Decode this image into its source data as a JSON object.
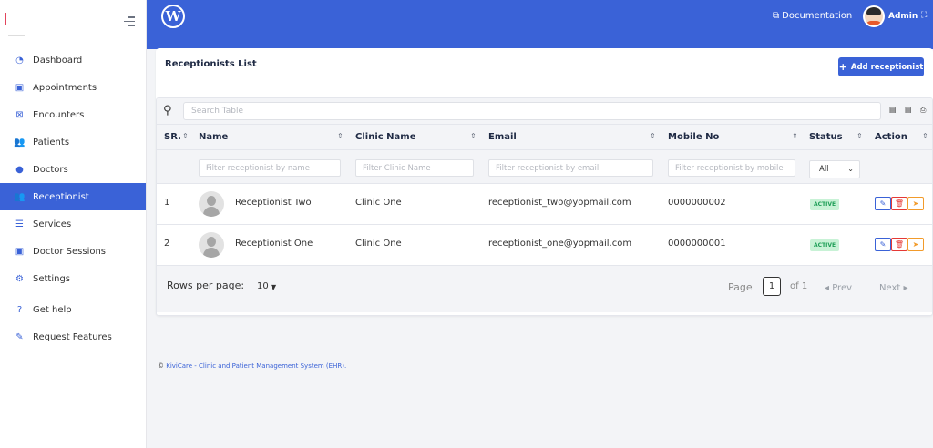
{
  "sidebar": {
    "items": [
      {
        "label": "Dashboard",
        "icon": "dashboard-icon"
      },
      {
        "label": "Appointments",
        "icon": "calendar-icon"
      },
      {
        "label": "Encounters",
        "icon": "calendar-x-icon"
      },
      {
        "label": "Patients",
        "icon": "patients-icon"
      },
      {
        "label": "Doctors",
        "icon": "user-icon"
      },
      {
        "label": "Receptionist",
        "icon": "users-icon",
        "active": true
      },
      {
        "label": "Services",
        "icon": "list-icon"
      },
      {
        "label": "Doctor Sessions",
        "icon": "calendar-icon"
      },
      {
        "label": "Settings",
        "icon": "gears-icon"
      },
      {
        "label": "Get help",
        "icon": "help-icon"
      },
      {
        "label": "Request Features",
        "icon": "edit-icon"
      }
    ]
  },
  "topbar": {
    "documentation_label": "Documentation",
    "user_name": "Admin"
  },
  "card": {
    "title": "Receptionists List",
    "add_button_label": "Add receptionist"
  },
  "table": {
    "search_placeholder": "Search Table",
    "columns": [
      "SR.",
      "Name",
      "Clinic Name",
      "Email",
      "Mobile No",
      "Status",
      "Action"
    ],
    "filters": {
      "name": "Filter receptionist by name",
      "clinic": "Filter Clinic Name",
      "email": "Filter receptionist by email",
      "mobile": "Filter receptionist by mobile",
      "status": "All"
    },
    "rows": [
      {
        "sr": "1",
        "name": "Receptionist Two",
        "clinic": "Clinic One",
        "email": "receptionist_two@yopmail.com",
        "mobile": "0000000002",
        "status": "ACTIVE"
      },
      {
        "sr": "2",
        "name": "Receptionist One",
        "clinic": "Clinic One",
        "email": "receptionist_one@yopmail.com",
        "mobile": "0000000001",
        "status": "ACTIVE"
      }
    ]
  },
  "pagination": {
    "rows_per_page_label": "Rows per page:",
    "rows_per_page_value": "10",
    "page_label": "Page",
    "current_page": "1",
    "of_label": "of 1",
    "prev_label": "Prev",
    "next_label": "Next"
  },
  "footer": {
    "prefix": "©",
    "link_text": "KiviCare - Clinic and Patient Management System (EHR)."
  },
  "colors": {
    "primary": "#3a62d7",
    "active_badge_bg": "#c8f2d6",
    "active_badge_text": "#1e9e57",
    "delete": "#e53935",
    "send": "#f29b2b"
  }
}
